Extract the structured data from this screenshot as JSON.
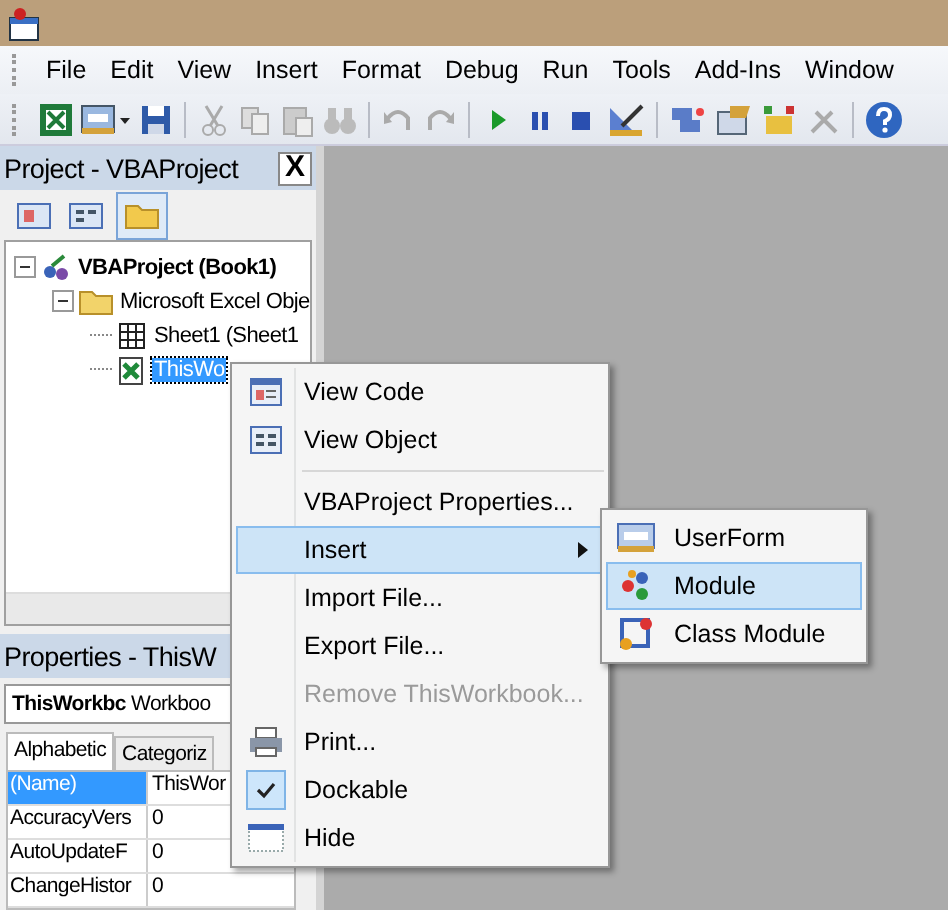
{
  "menu_bar": [
    "File",
    "Edit",
    "View",
    "Insert",
    "Format",
    "Debug",
    "Run",
    "Tools",
    "Add-Ins",
    "Window"
  ],
  "project_pane": {
    "title": "Project - VBAProject",
    "close": "X",
    "tree": [
      {
        "kind": "project",
        "label": "VBAProject (Book1)",
        "expanded": true,
        "selected": false,
        "children": [
          {
            "kind": "folder",
            "label": "Microsoft Excel Obje",
            "expanded": true,
            "selected": false,
            "children": [
              {
                "kind": "sheet",
                "label": "Sheet1 (Sheet1",
                "selected": false
              },
              {
                "kind": "workbook",
                "label": "ThisWo",
                "selected": true
              }
            ]
          }
        ]
      }
    ]
  },
  "properties_pane": {
    "title": "Properties - ThisW",
    "object_name": "ThisWorkbc",
    "object_type": "Workboo",
    "tabs": [
      {
        "label": "Alphabetic",
        "selected": true
      },
      {
        "label": "Categoriz",
        "selected": false
      }
    ],
    "rows": [
      {
        "name": "(Name)",
        "value": "ThisWor",
        "selected": true
      },
      {
        "name": "AccuracyVers",
        "value": "0",
        "selected": false
      },
      {
        "name": "AutoUpdateF",
        "value": "0",
        "selected": false
      },
      {
        "name": "ChangeHistor",
        "value": "0",
        "selected": false
      }
    ]
  },
  "context_menu": [
    {
      "kind": "item",
      "label": "View Code",
      "selected": false,
      "disabled": false
    },
    {
      "kind": "item",
      "label": "View Object",
      "selected": false,
      "disabled": false
    },
    {
      "kind": "separator"
    },
    {
      "kind": "item",
      "label": "VBAProject Properties...",
      "selected": false,
      "disabled": false
    },
    {
      "kind": "submenu",
      "label": "Insert",
      "selected": true,
      "disabled": false
    },
    {
      "kind": "item",
      "label": "Import File...",
      "selected": false,
      "disabled": false
    },
    {
      "kind": "item",
      "label": "Export File...",
      "selected": false,
      "disabled": false
    },
    {
      "kind": "item",
      "label": "Remove ThisWorkbook...",
      "selected": false,
      "disabled": true
    },
    {
      "kind": "item",
      "label": "Print...",
      "selected": false,
      "disabled": false
    },
    {
      "kind": "check",
      "label": "Dockable",
      "checked": true,
      "selected": false,
      "disabled": false
    },
    {
      "kind": "item",
      "label": "Hide",
      "selected": false,
      "disabled": false
    }
  ],
  "submenu": [
    {
      "label": "UserForm",
      "selected": false
    },
    {
      "label": "Module",
      "selected": true
    },
    {
      "label": "Class Module",
      "selected": false
    }
  ]
}
